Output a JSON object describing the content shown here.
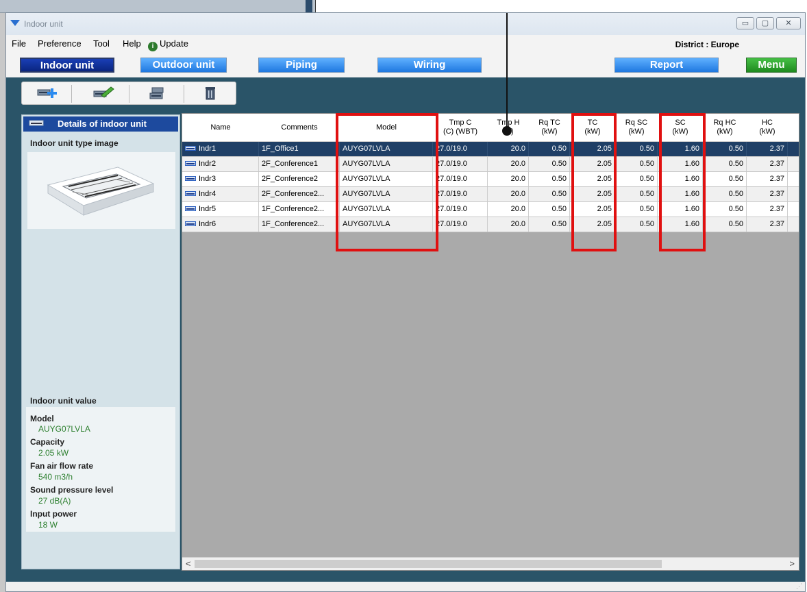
{
  "window": {
    "title": "Indoor unit",
    "controls": {
      "minimize": "▭",
      "maximize": "▢",
      "close": "✕"
    }
  },
  "menubar": {
    "items": [
      "File",
      "Preference",
      "Tool",
      "Help"
    ],
    "update_label": "Update",
    "update_icon": "i",
    "district": "District : Europe"
  },
  "nav": {
    "indoor": "Indoor unit",
    "outdoor": "Outdoor unit",
    "piping": "Piping",
    "wiring": "Wiring",
    "report": "Report",
    "menu": "Menu"
  },
  "left_panel": {
    "header": "Details of indoor unit",
    "type_image_label": "Indoor unit type image",
    "value_label": "Indoor unit value",
    "values": [
      {
        "label": "Model",
        "value": "AUYG07LVLA"
      },
      {
        "label": "Capacity",
        "value": "2.05 kW"
      },
      {
        "label": "Fan air flow rate",
        "value": "540 m3/h"
      },
      {
        "label": "Sound pressure level",
        "value": "27 dB(A)"
      },
      {
        "label": "Input power",
        "value": "18 W"
      }
    ]
  },
  "grid": {
    "headers": [
      "Name",
      "Comments",
      "Model",
      "Tmp C\n(C) (WBT)",
      "Tmp H\n(C)",
      "Rq TC\n(kW)",
      "TC\n(kW)",
      "Rq SC\n(kW)",
      "SC\n(kW)",
      "Rq HC\n(kW)",
      "HC\n(kW)"
    ],
    "rows": [
      [
        "Indr1",
        "1F_Office1",
        "AUYG07LVLA",
        "27.0/19.0",
        "20.0",
        "0.50",
        "2.05",
        "0.50",
        "1.60",
        "0.50",
        "2.37"
      ],
      [
        "Indr2",
        "2F_Conference1",
        "AUYG07LVLA",
        "27.0/19.0",
        "20.0",
        "0.50",
        "2.05",
        "0.50",
        "1.60",
        "0.50",
        "2.37"
      ],
      [
        "Indr3",
        "2F_Conference2",
        "AUYG07LVLA",
        "27.0/19.0",
        "20.0",
        "0.50",
        "2.05",
        "0.50",
        "1.60",
        "0.50",
        "2.37"
      ],
      [
        "Indr4",
        "2F_Conference2...",
        "AUYG07LVLA",
        "27.0/19.0",
        "20.0",
        "0.50",
        "2.05",
        "0.50",
        "1.60",
        "0.50",
        "2.37"
      ],
      [
        "Indr5",
        "1F_Conference2...",
        "AUYG07LVLA",
        "27.0/19.0",
        "20.0",
        "0.50",
        "2.05",
        "0.50",
        "1.60",
        "0.50",
        "2.37"
      ],
      [
        "Indr6",
        "1F_Conference2...",
        "AUYG07LVLA",
        "27.0/19.0",
        "20.0",
        "0.50",
        "2.05",
        "0.50",
        "1.60",
        "0.50",
        "2.37"
      ]
    ],
    "selected_row": 0,
    "scroll_left": "<",
    "scroll_right": ">"
  },
  "colors": {
    "highlight": "#e01010",
    "selection": "#1f3f66",
    "panel_bg": "#2a5468",
    "value_text": "#2e8030"
  }
}
